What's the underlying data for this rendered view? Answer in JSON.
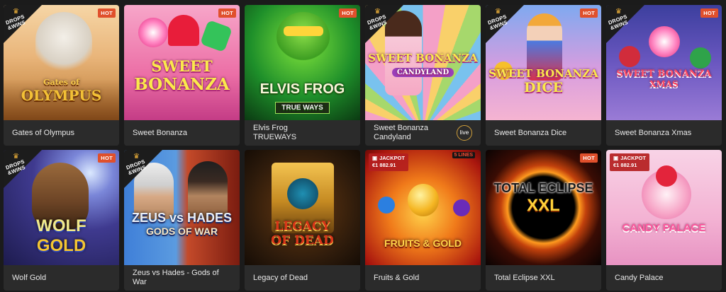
{
  "badges": {
    "hot": "HOT",
    "drops_line1": "DROPS",
    "drops_line2": "&WINS",
    "live": "live",
    "jackpot_label": "JACKPOT",
    "lines": "5 LINES"
  },
  "games": [
    {
      "name": "Gates of Olympus",
      "logo1": "Gates of",
      "logo2": "OLYMPUS",
      "hot": true,
      "drops": true
    },
    {
      "name": "Sweet Bonanza",
      "logo1": "SWEET",
      "logo2": "BONANZA",
      "hot": true,
      "drops": false
    },
    {
      "name": "Elvis Frog TRUEWAYS",
      "logo1": "ELVIS FROG",
      "logo2": "TRUE WAYS",
      "hot": true,
      "drops": false
    },
    {
      "name": "Sweet Bonanza Candyland",
      "logo1": "SWEET BONANZA",
      "logo2": "CANDYLAND",
      "hot": false,
      "drops": true,
      "live": true
    },
    {
      "name": "Sweet Bonanza Dice",
      "logo1": "SWEET BONANZA",
      "logo2": "DICE",
      "hot": true,
      "drops": true
    },
    {
      "name": "Sweet Bonanza Xmas",
      "logo1": "SWEET BONANZA",
      "logo2": "XMAS",
      "hot": true,
      "drops": true
    },
    {
      "name": "Wolf Gold",
      "logo1": "WOLF",
      "logo2": "GOLD",
      "hot": true,
      "drops": true
    },
    {
      "name": "Zeus vs Hades - Gods of War",
      "logo1": "ZEUS vs HADES",
      "logo2": "GODS OF WAR",
      "hot": false,
      "drops": true
    },
    {
      "name": "Legacy of Dead",
      "logo1": "LEGACY",
      "logo2": "OF DEAD",
      "hot": false,
      "drops": false
    },
    {
      "name": "Fruits & Gold",
      "logo1": "",
      "logo2": "FRUITS & GOLD",
      "hot": false,
      "drops": false,
      "jackpot": "€1 882.91",
      "lines": true
    },
    {
      "name": "Total Eclipse XXL",
      "logo1": "TOTAL ECLIPSE",
      "logo2": "XXL",
      "hot": true,
      "drops": false
    },
    {
      "name": "Candy Palace",
      "logo1": "",
      "logo2": "CANDY PALACE",
      "hot": false,
      "drops": false,
      "jackpot": "€1 882.91"
    }
  ],
  "colors": {
    "page_bg": "#1b1b1b",
    "caption_bg": "#2b2b2b",
    "hot": "#e0502c",
    "live_ring": "#d1a03b",
    "jackpot_bg": "#b41e1e"
  }
}
